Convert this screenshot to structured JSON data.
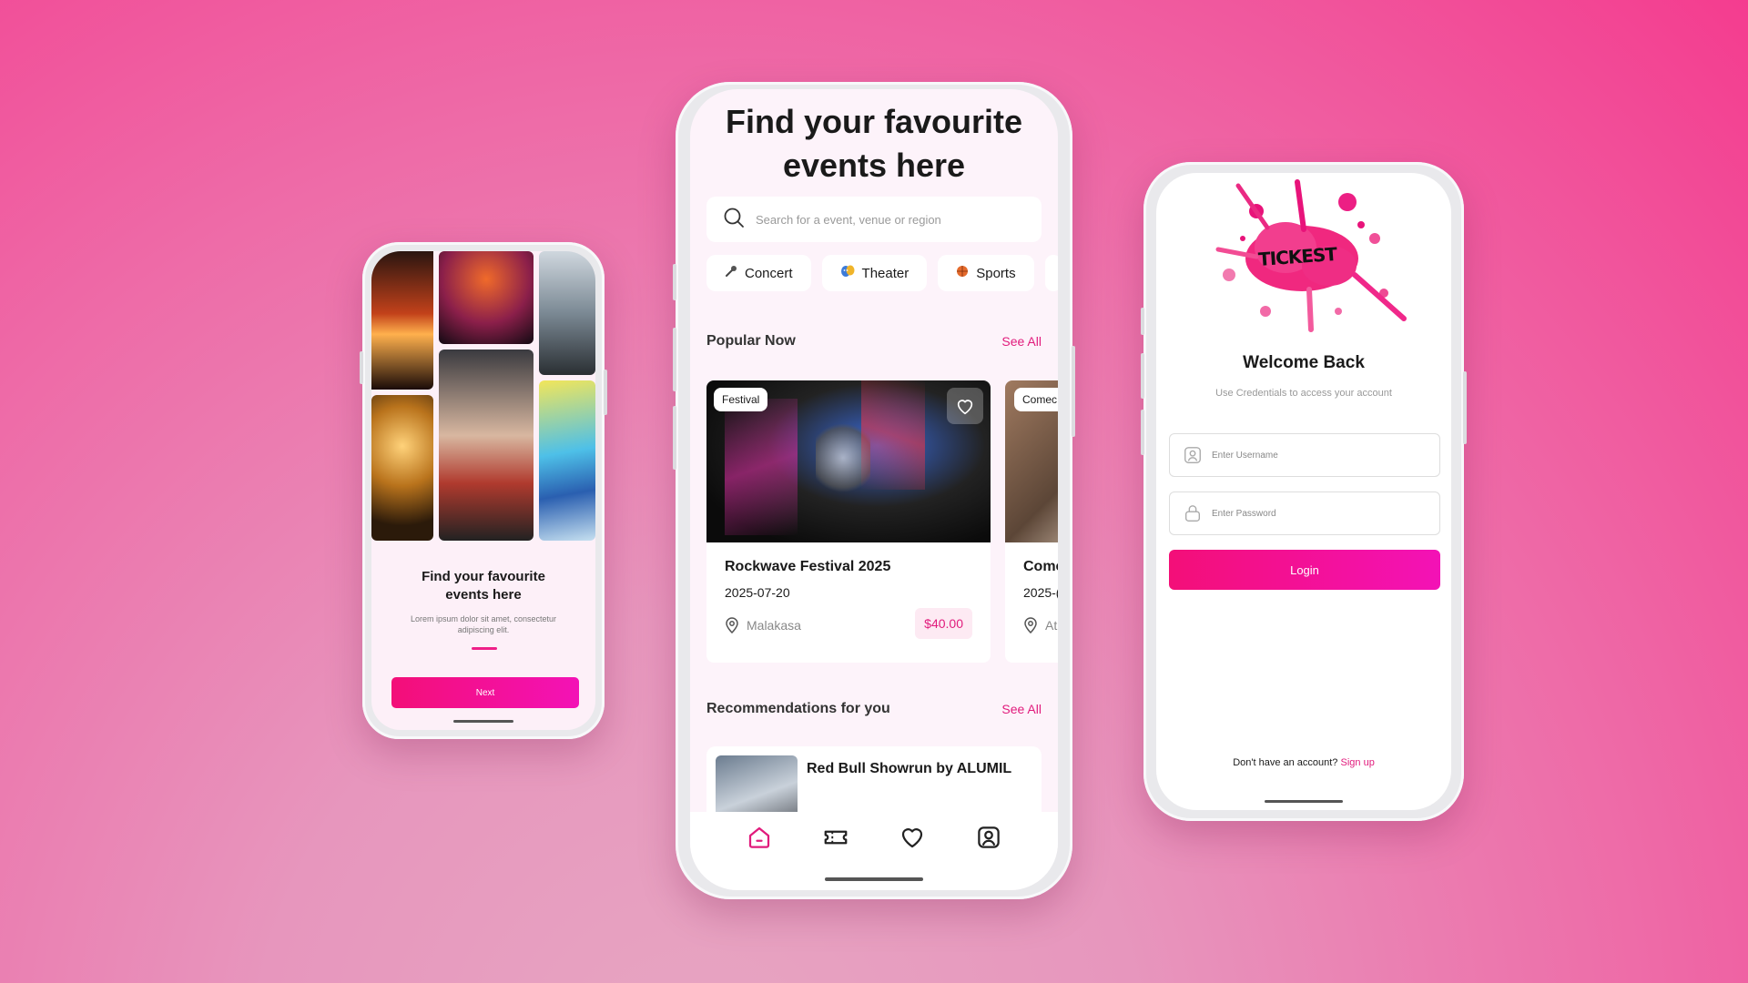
{
  "colors": {
    "accent": "#e11b7c",
    "button_start": "#f30f78",
    "button_end": "#f312b6"
  },
  "onboarding": {
    "title": "Find your favourite events here",
    "subtitle": "Lorem ipsum dolor sit amet, consectetur adipiscing elit.",
    "next_label": "Next"
  },
  "home": {
    "title": "Find your favourite events here",
    "search": {
      "placeholder": "Search for a event, venue or region",
      "icon": "search-icon"
    },
    "categories": [
      {
        "label": "Concert",
        "icon": "microphone-icon"
      },
      {
        "label": "Theater",
        "icon": "theater-masks-icon"
      },
      {
        "label": "Sports",
        "icon": "basketball-icon"
      }
    ],
    "popular": {
      "title": "Popular Now",
      "see_all": "See All",
      "cards": [
        {
          "tag": "Festival",
          "title": "Rockwave Festival 2025",
          "date": "2025-07-20",
          "location": "Malakasa",
          "price": "$40.00"
        },
        {
          "tag": "Comec",
          "title": "Come",
          "date": "2025-(",
          "location": "At"
        }
      ]
    },
    "recommendations": {
      "title": "Recommendations for you",
      "see_all": "See All",
      "items": [
        {
          "title": "Red Bull Showrun by ALUMIL"
        }
      ]
    },
    "tabbar": [
      "home-icon",
      "ticket-icon",
      "heart-icon",
      "profile-icon"
    ]
  },
  "login": {
    "logo_text": "TICKEST",
    "title": "Welcome Back",
    "subtitle": "Use Credentials to access your account",
    "username_placeholder": "Enter Username",
    "password_placeholder": "Enter Password",
    "login_label": "Login",
    "signup_prompt": "Don't have an account?",
    "signup_link": "Sign up"
  }
}
